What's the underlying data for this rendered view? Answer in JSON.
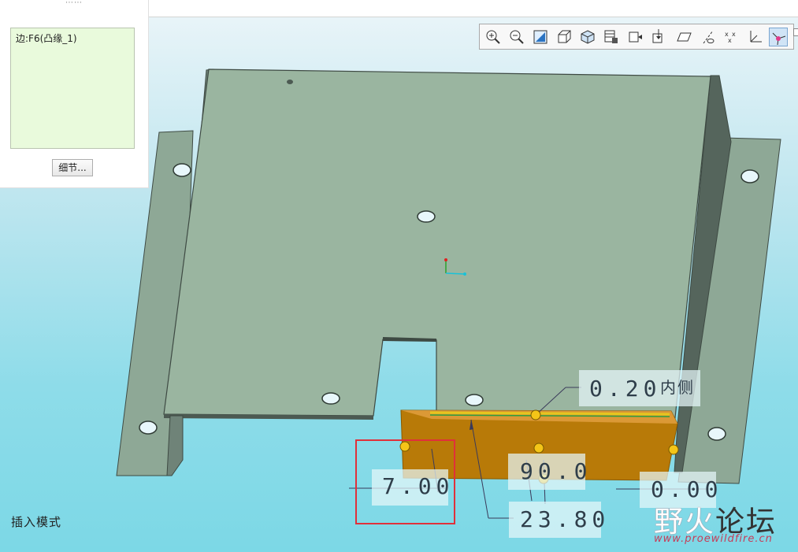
{
  "panel": {
    "grip": "⋯⋯",
    "edge_item": "边:F6(凸缘_1)",
    "details_button": "细节..."
  },
  "toolbar": {
    "tools": [
      {
        "name": "zoom-in-icon"
      },
      {
        "name": "zoom-out-icon"
      },
      {
        "name": "refit-icon"
      },
      {
        "name": "display-style-icon"
      },
      {
        "name": "view-orientation-icon"
      },
      {
        "name": "view-manager-icon"
      },
      {
        "name": "perspective-icon"
      },
      {
        "name": "section-icon"
      },
      {
        "name": "datum-plane-display-icon"
      },
      {
        "name": "datum-axis-display-icon"
      },
      {
        "name": "datum-point-display-icon"
      },
      {
        "name": "coordinate-system-display-icon"
      },
      {
        "name": "annotation-display-icon",
        "active": true
      }
    ]
  },
  "dimensions": {
    "bend_radius": "0.20",
    "bend_side": "内侧",
    "flange_length": "7.00",
    "angle": "90.0",
    "height": "23.80",
    "offset": "0.00"
  },
  "status": {
    "mode": "插入模式"
  },
  "watermark": {
    "text_a": "野",
    "text_b": "火",
    "text_c": "论坛",
    "url": "www.proewildfire.cn"
  },
  "colors": {
    "background_top": "#ffffff",
    "background_bottom": "#7cd8e6",
    "part_face": "#9ab5a0",
    "part_side": "#5f7066",
    "flange": "#b87a08",
    "highlight_box": "#e0303a",
    "handle": "#f4c518"
  }
}
